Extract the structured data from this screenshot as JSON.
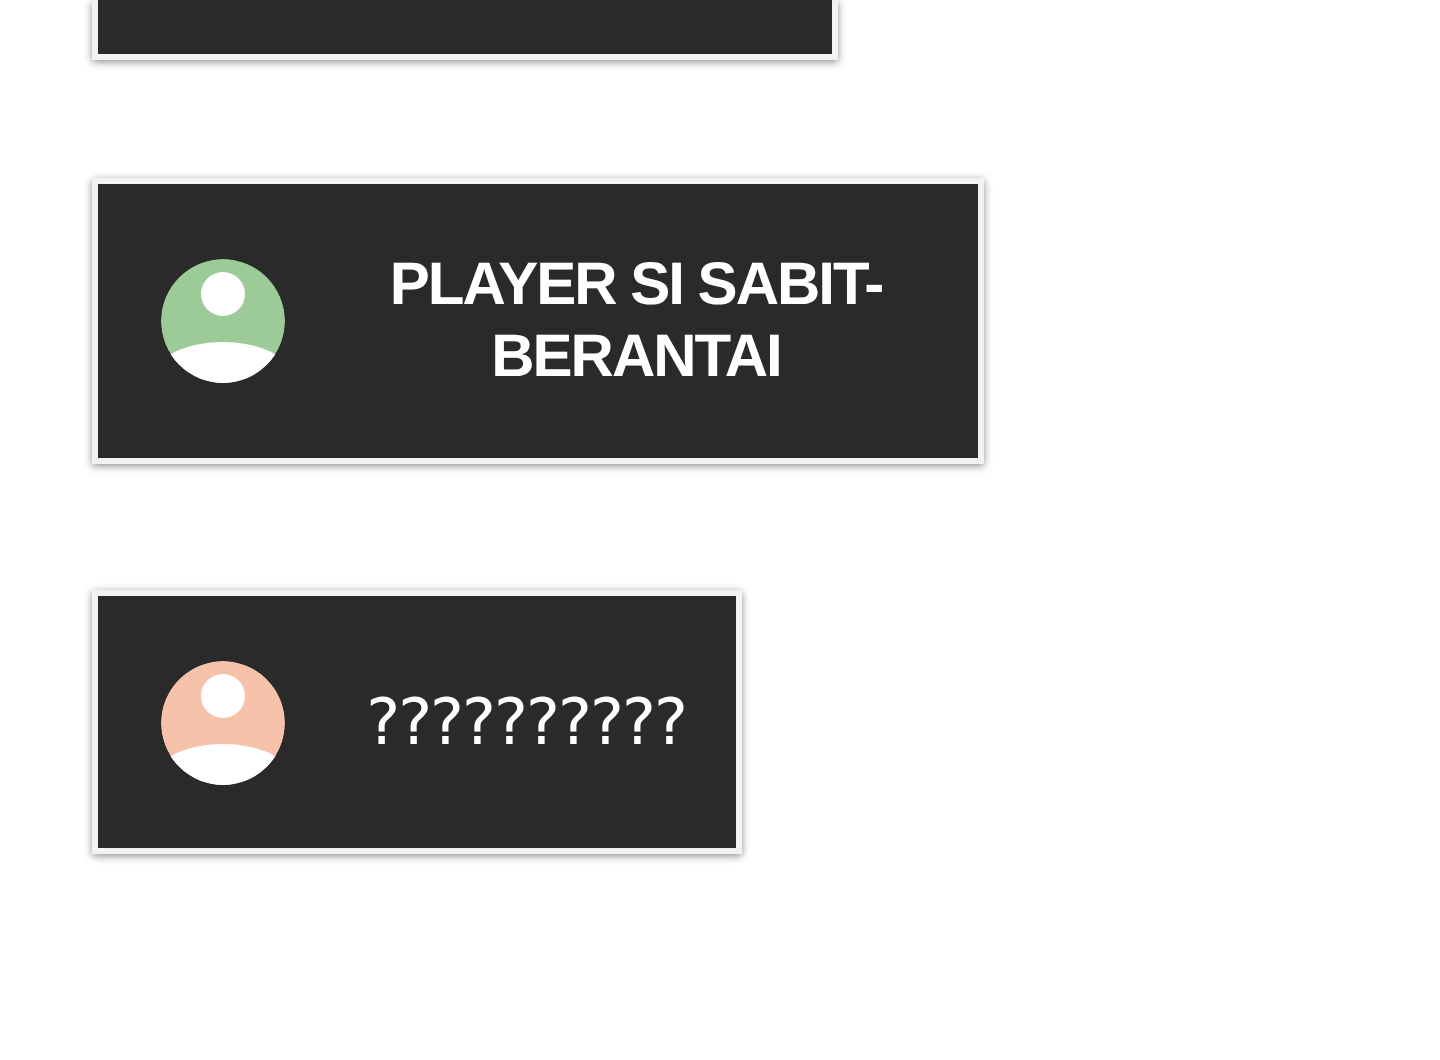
{
  "cards": [
    {
      "kind": "empty"
    },
    {
      "kind": "player",
      "name": "PLAYER SI SABIT-BERANTAI",
      "color": "#9ccb98",
      "bold": true
    },
    {
      "kind": "player",
      "name": "??????????",
      "color": "#f6c3aa",
      "bold": false
    }
  ]
}
